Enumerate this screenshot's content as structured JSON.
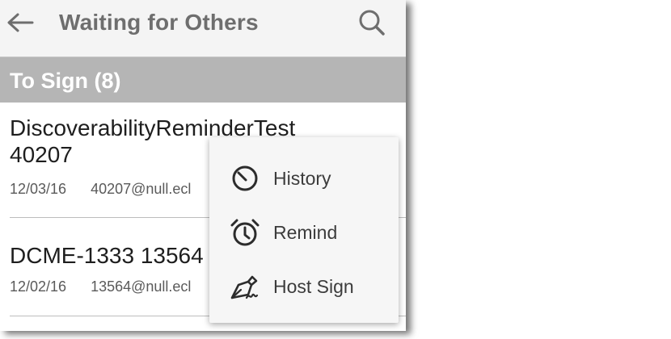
{
  "appbar": {
    "title": "Waiting for Others",
    "back_icon": "arrow-left-icon",
    "search_icon": "search-icon"
  },
  "section": {
    "title": "To Sign (8)"
  },
  "rows": [
    {
      "title": "DiscoverabilityReminderTest\n40207",
      "date": "12/03/16",
      "email": "40207@null.ecl"
    },
    {
      "title": "DCME-1333 13564",
      "date": "12/02/16",
      "email": "13564@null.ecl"
    }
  ],
  "menu": {
    "items": [
      {
        "label": "History",
        "icon": "history-icon"
      },
      {
        "label": "Remind",
        "icon": "alarm-clock-icon"
      },
      {
        "label": "Host Sign",
        "icon": "pen-sign-icon"
      }
    ]
  },
  "colors": {
    "appbar_bg": "#f4f4f4",
    "section_header_bg": "#b5b5b5",
    "menu_bg": "#f6f6f6"
  }
}
